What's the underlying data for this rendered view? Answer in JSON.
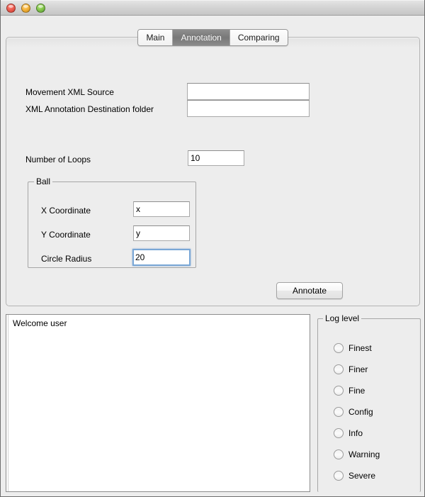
{
  "window": {
    "traffic_lights": [
      "close",
      "minimize",
      "zoom"
    ]
  },
  "tabs": [
    {
      "label": "Main",
      "selected": false
    },
    {
      "label": "Annotation",
      "selected": true
    },
    {
      "label": "Comparing",
      "selected": false
    }
  ],
  "annotation_panel": {
    "fields": [
      {
        "label": "Movement XML Source",
        "value": "",
        "placeholder": ""
      },
      {
        "label": "XML Annotation Destination folder",
        "value": "",
        "placeholder": ""
      }
    ],
    "loops": {
      "label": "Number of Loops",
      "value": "10"
    },
    "ball_group": {
      "title": "Ball",
      "fields": [
        {
          "label": "X Coordinate",
          "value": "x",
          "focused": false
        },
        {
          "label": "Y Coordinate",
          "value": "y",
          "focused": false
        },
        {
          "label": "Circle Radius",
          "value": "20",
          "focused": true
        }
      ]
    },
    "annotate_button": {
      "label": "Annotate"
    }
  },
  "log": {
    "text": "Welcome user"
  },
  "log_level": {
    "title": "Log level",
    "options": [
      {
        "label": "Finest",
        "selected": false
      },
      {
        "label": "Finer",
        "selected": false
      },
      {
        "label": "Fine",
        "selected": false
      },
      {
        "label": "Config",
        "selected": false
      },
      {
        "label": "Info",
        "selected": false
      },
      {
        "label": "Warning",
        "selected": false
      },
      {
        "label": "Severe",
        "selected": false
      }
    ]
  },
  "colors": {
    "window_bg": "#ededed",
    "selected_tab_bg": "#7d7d7d",
    "focus_border": "#7aa7d6",
    "field_bg": "#ffffff"
  }
}
